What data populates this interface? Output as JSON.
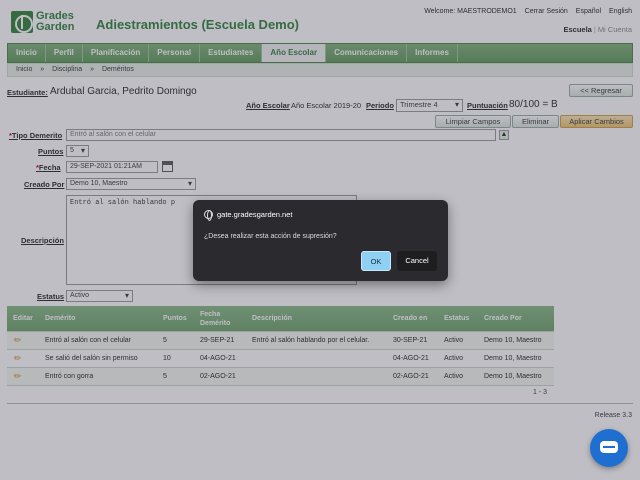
{
  "header": {
    "logo_text_1": "Grades",
    "logo_text_2": "Garden",
    "title": "Adiestramientos (Escuela Demo)",
    "welcome": "Welcome: MAESTRODEMO1",
    "logout": "Cerrar Sesión",
    "lang_es": "Español",
    "lang_en": "English",
    "school_link": "Escuela",
    "account_link": "Mi Cuenta"
  },
  "nav": {
    "items": [
      {
        "label": "Inicio"
      },
      {
        "label": "Perfil"
      },
      {
        "label": "Planificación"
      },
      {
        "label": "Personal"
      },
      {
        "label": "Estudiantes"
      },
      {
        "label": "Año Escolar"
      },
      {
        "label": "Comunicaciones"
      },
      {
        "label": "Informes"
      }
    ]
  },
  "breadcrumb": [
    "Inicio",
    "»",
    "Disciplina",
    "»",
    "Deméritos"
  ],
  "student": {
    "label": "Estudiante:",
    "name": "Ardubal Garcia, Pedrito Domingo",
    "back_button": "<< Regresar",
    "year_label": "Año Escolar",
    "year_value": "Año Escolar 2019-20",
    "period_label": "Periodo",
    "period_value": "Trimestre 4",
    "score_label": "Puntuación",
    "score_value": "80/100 = B"
  },
  "actions": {
    "clear": "Limpiar Campos",
    "delete": "Eliminar",
    "apply": "Aplicar Cambios"
  },
  "form": {
    "type_label": "Tipo Demerito",
    "type_placeholder": "Entró al salón con el celular",
    "points_label": "Puntos",
    "points_value": "5",
    "date_label": "Fecha",
    "date_value": "29-SEP-2021 01:21AM",
    "created_by_label": "Creado Por",
    "created_by_value": "Demo 10, Maestro",
    "description_label": "Descripción",
    "description_value": "Entró al salón hablando p",
    "status_label": "Estatus",
    "status_value": "Activo"
  },
  "table": {
    "headers": [
      "Editar",
      "Demérito",
      "Puntos",
      "Fecha Demérito",
      "Descripción",
      "Creado en",
      "Estatus",
      "Creado Por"
    ],
    "rows": [
      {
        "demerit": "Entró al salón con el celular",
        "points": "5",
        "date": "29-SEP-21",
        "description": "Entró al salón hablando por el celular.",
        "created": "30-SEP-21",
        "status": "Activo",
        "by": "Demo 10, Maestro"
      },
      {
        "demerit": "Se salió del salón sin permiso",
        "points": "10",
        "date": "04-AGO-21",
        "description": "",
        "created": "04-AGO-21",
        "status": "Activo",
        "by": "Demo 10, Maestro"
      },
      {
        "demerit": "Entró con gorra",
        "points": "5",
        "date": "02-AGO-21",
        "description": "",
        "created": "02-AGO-21",
        "status": "Activo",
        "by": "Demo 10, Maestro"
      }
    ],
    "pager": "1 - 3"
  },
  "footer": {
    "release": "Release 3.3"
  },
  "dialog": {
    "host": "gate.gradesgarden.net",
    "message": "¿Desea realizar esta acción de supresión?",
    "ok": "OK",
    "cancel": "Cancel"
  }
}
